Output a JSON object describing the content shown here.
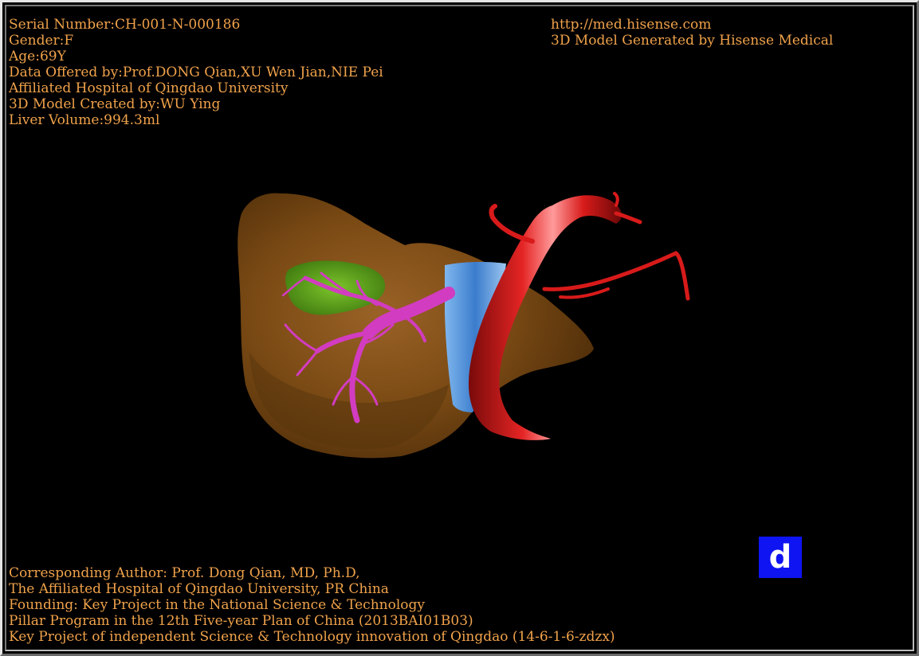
{
  "header_left": {
    "serial": "Serial Number:CH-001-N-000186",
    "gender": "Gender:F",
    "age": "Age:69Y",
    "data_offered": "Data Offered by:Prof.DONG Qian,XU Wen Jian,NIE Pei",
    "hospital": "Affiliated Hospital of Qingdao University",
    "model_created": "3D Model Created by:WU Ying",
    "liver_volume": "Liver Volume:994.3ml"
  },
  "header_right": {
    "url": "http://med.hisense.com",
    "generated": "3D Model Generated by Hisense Medical"
  },
  "footer": {
    "line1": "Corresponding Author: Prof. Dong Qian, MD, Ph.D,",
    "line2": "The Affiliated Hospital of Qingdao University, PR China",
    "line3": "Founding: Key Project in the National Science & Technology",
    "line4": "Pillar Program in the 12th Five-year Plan of China (2013BAI01B03)",
    "line5": "Key Project of independent Science & Technology innovation of Qingdao (14-6-1-6-zdzx)"
  },
  "view_button": {
    "label": "d"
  },
  "colors": {
    "text": "#f0a24b",
    "liver": "#7a4a14",
    "gallbladder": "#5aa01c",
    "portal_vein": "#d23cc0",
    "ivc": "#4a8fd8",
    "aorta": "#d01818",
    "view_button_bg": "#0f14f2"
  }
}
